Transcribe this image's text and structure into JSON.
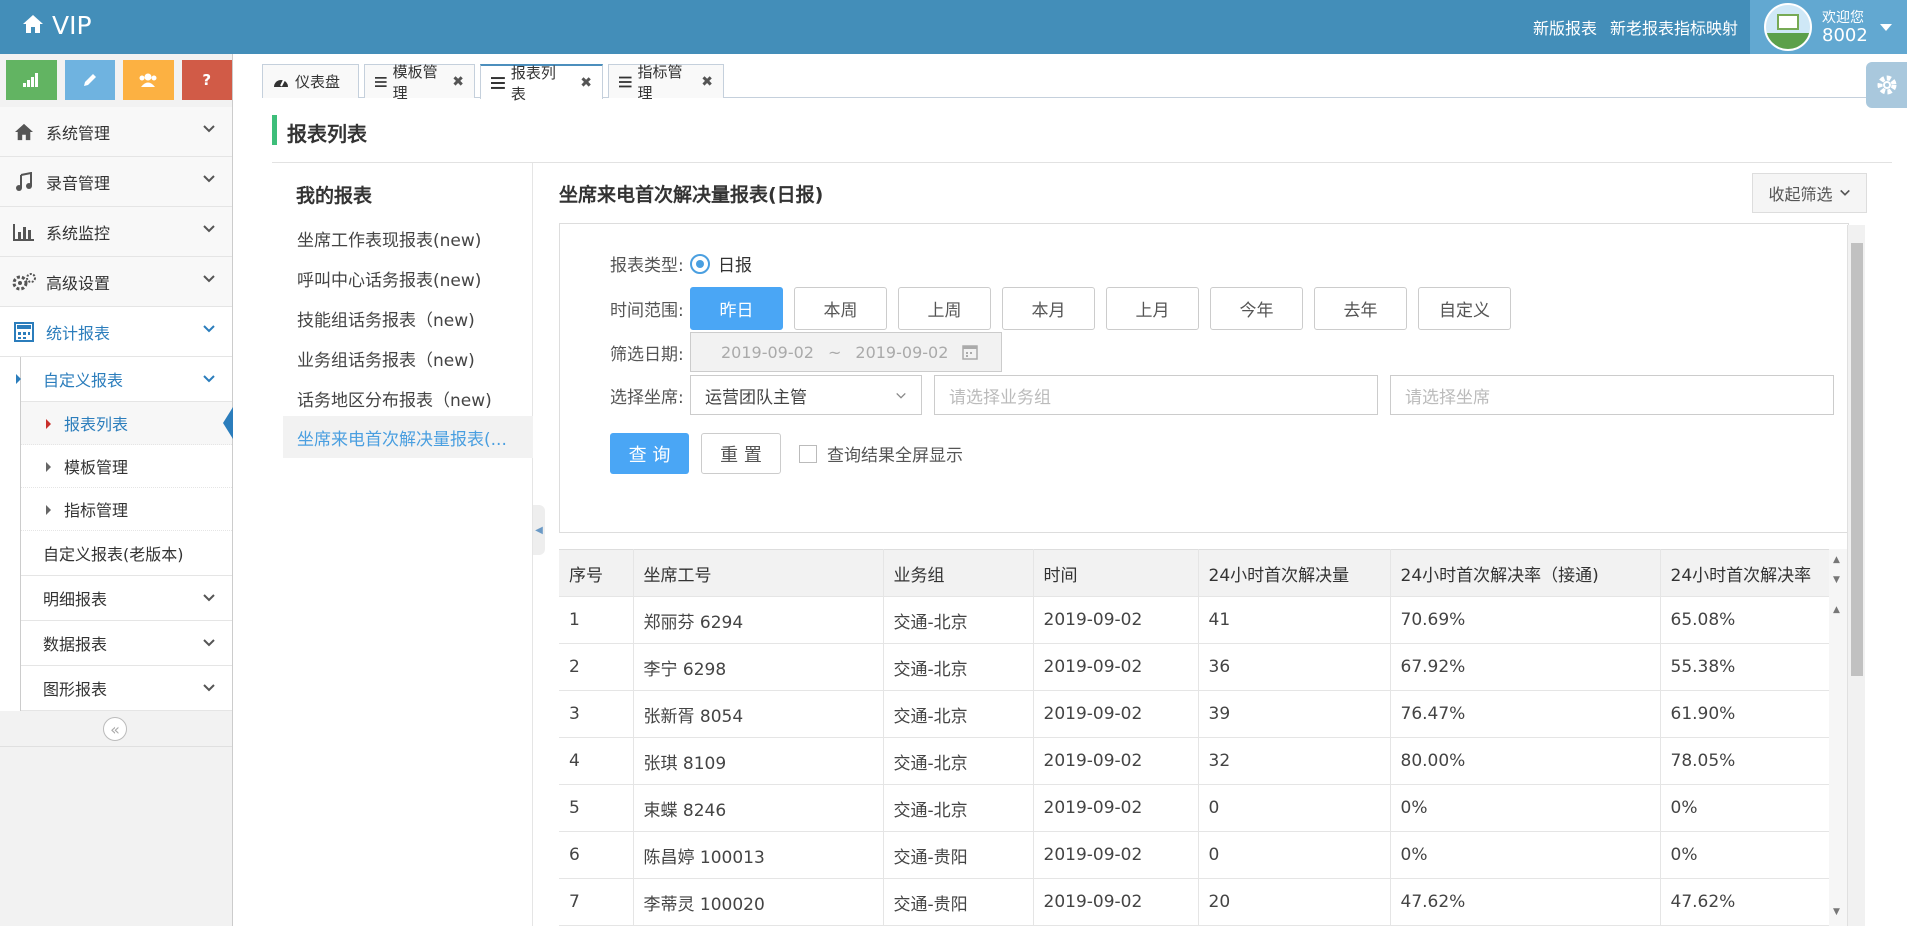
{
  "app": {
    "brand": "VIP"
  },
  "header": {
    "links": [
      "新版报表",
      "新老报表指标映射"
    ],
    "user": {
      "welcome": "欢迎您",
      "id": "8002"
    }
  },
  "shortcuts": [
    {
      "icon": "signal-icon",
      "color": "#62b462"
    },
    {
      "icon": "pencil-icon",
      "color": "#6fb3e0"
    },
    {
      "icon": "users-icon",
      "color": "#fcb142"
    },
    {
      "icon": "question-icon",
      "color": "#d15b47"
    }
  ],
  "sidebar": {
    "items": [
      "系统管理",
      "录音管理",
      "系统监控",
      "高级设置",
      "统计报表"
    ],
    "sub": [
      "自定义报表",
      "自定义报表(老版本)",
      "明细报表",
      "数据报表",
      "图形报表"
    ],
    "sub2": [
      "报表列表",
      "模板管理",
      "指标管理"
    ]
  },
  "tabs": [
    "仪表盘",
    "模板管理",
    "报表列表",
    "指标管理"
  ],
  "page": {
    "title": "报表列表"
  },
  "reports": {
    "heading": "我的报表",
    "items": [
      "坐席工作表现报表(new)",
      "呼叫中心话务报表(new)",
      "技能组话务报表（new)",
      "业务组话务报表（new)",
      "话务地区分布报表（new)",
      "坐席来电首次解决量报表(..."
    ]
  },
  "main": {
    "title": "坐席来电首次解决量报表(日报)",
    "collapse": "收起筛选",
    "filter": {
      "type_label": "报表类型:",
      "type_value": "日报",
      "range_label": "时间范围:",
      "ranges": [
        "昨日",
        "本周",
        "上周",
        "本月",
        "上月",
        "今年",
        "去年",
        "自定义"
      ],
      "date_label": "筛选日期:",
      "date_from": "2019-09-02",
      "date_sep": "~",
      "date_to": "2019-09-02",
      "agent_label": "选择坐席:",
      "agent_select": "运营团队主管",
      "group_placeholder": "请选择业务组",
      "agent_placeholder": "请选择坐席",
      "query": "查 询",
      "reset": "重 置",
      "fullscreen": "查询结果全屏显示"
    },
    "table": {
      "headers": [
        "序号",
        "坐席工号",
        "业务组",
        "时间",
        "24小时首次解决量",
        "24小时首次解决率（接通)",
        "24小时首次解决率"
      ],
      "rows": [
        [
          "1",
          "郑丽芬 6294",
          "交通-北京",
          "2019-09-02",
          "41",
          "70.69%",
          "65.08%"
        ],
        [
          "2",
          "李宁 6298",
          "交通-北京",
          "2019-09-02",
          "36",
          "67.92%",
          "55.38%"
        ],
        [
          "3",
          "张新胥 8054",
          "交通-北京",
          "2019-09-02",
          "39",
          "76.47%",
          "61.90%"
        ],
        [
          "4",
          "张琪 8109",
          "交通-北京",
          "2019-09-02",
          "32",
          "80.00%",
          "78.05%"
        ],
        [
          "5",
          "束蝶 8246",
          "交通-北京",
          "2019-09-02",
          "0",
          "0%",
          "0%"
        ],
        [
          "6",
          "陈昌婷 100013",
          "交通-贵阳",
          "2019-09-02",
          "0",
          "0%",
          "0%"
        ],
        [
          "7",
          "李蒂灵 100020",
          "交通-贵阳",
          "2019-09-02",
          "20",
          "47.62%",
          "47.62%"
        ]
      ]
    }
  }
}
